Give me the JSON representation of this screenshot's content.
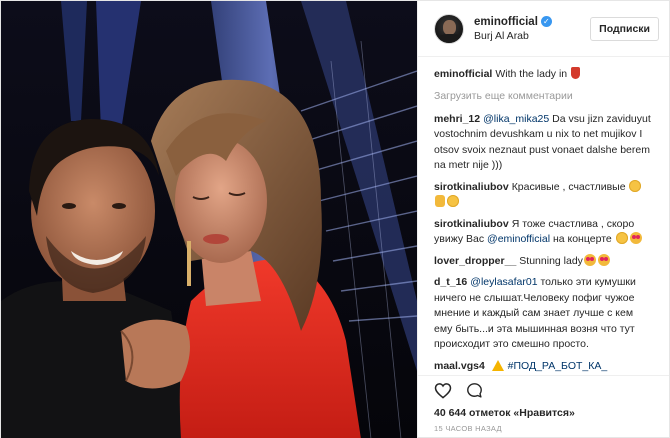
{
  "header": {
    "username": "eminofficial",
    "location": "Burj Al Arab",
    "follow_label": "Подписки"
  },
  "caption": {
    "username": "eminofficial",
    "text": "With the lady in"
  },
  "load_more_label": "Загрузить еще комментарии",
  "comments": [
    {
      "username": "mehri_12",
      "mention": "@lika_mika25",
      "text": "Da vsu jizn zaviduyut vostochnim devushkam u nix to net mujikov I otsov svoix neznaut pust vonaet dalshe berem na metr nije )))"
    },
    {
      "username": "sirotkinaliubov",
      "text": "Красивые , счастливые"
    },
    {
      "username": "sirotkinaliubov",
      "text_before": "Я тоже счастлива , скоро увижу Вас",
      "mention": "@eminofficial",
      "text_after": "на концерте"
    },
    {
      "username": "lover_dropper__",
      "text": "Stunning lady"
    },
    {
      "username": "d_t_16",
      "mention": "@leylasafar01",
      "text": "только эти кумушки ничего не слышат.Человеку пофиг чужое мнение и каждый сам знает лучше с кем ему быть...и эта мышинная возня что тут происходит это смешно просто."
    },
    {
      "username": "maal.vgs4",
      "hashtag": "#ПОД_РА_БОТ_КА_"
    }
  ],
  "likes": {
    "count": "40 644",
    "label": "отметок «Нравится»"
  },
  "timestamp": "15 ЧАСОВ НАЗАД",
  "icons": {
    "like": "heart-icon",
    "comment": "comment-bubble-icon",
    "verified": "verified-badge-icon"
  },
  "colors": {
    "verified_blue": "#3897f0",
    "mention_blue": "#003569",
    "muted_gray": "#999999",
    "dress_red": "#e02a1e"
  }
}
